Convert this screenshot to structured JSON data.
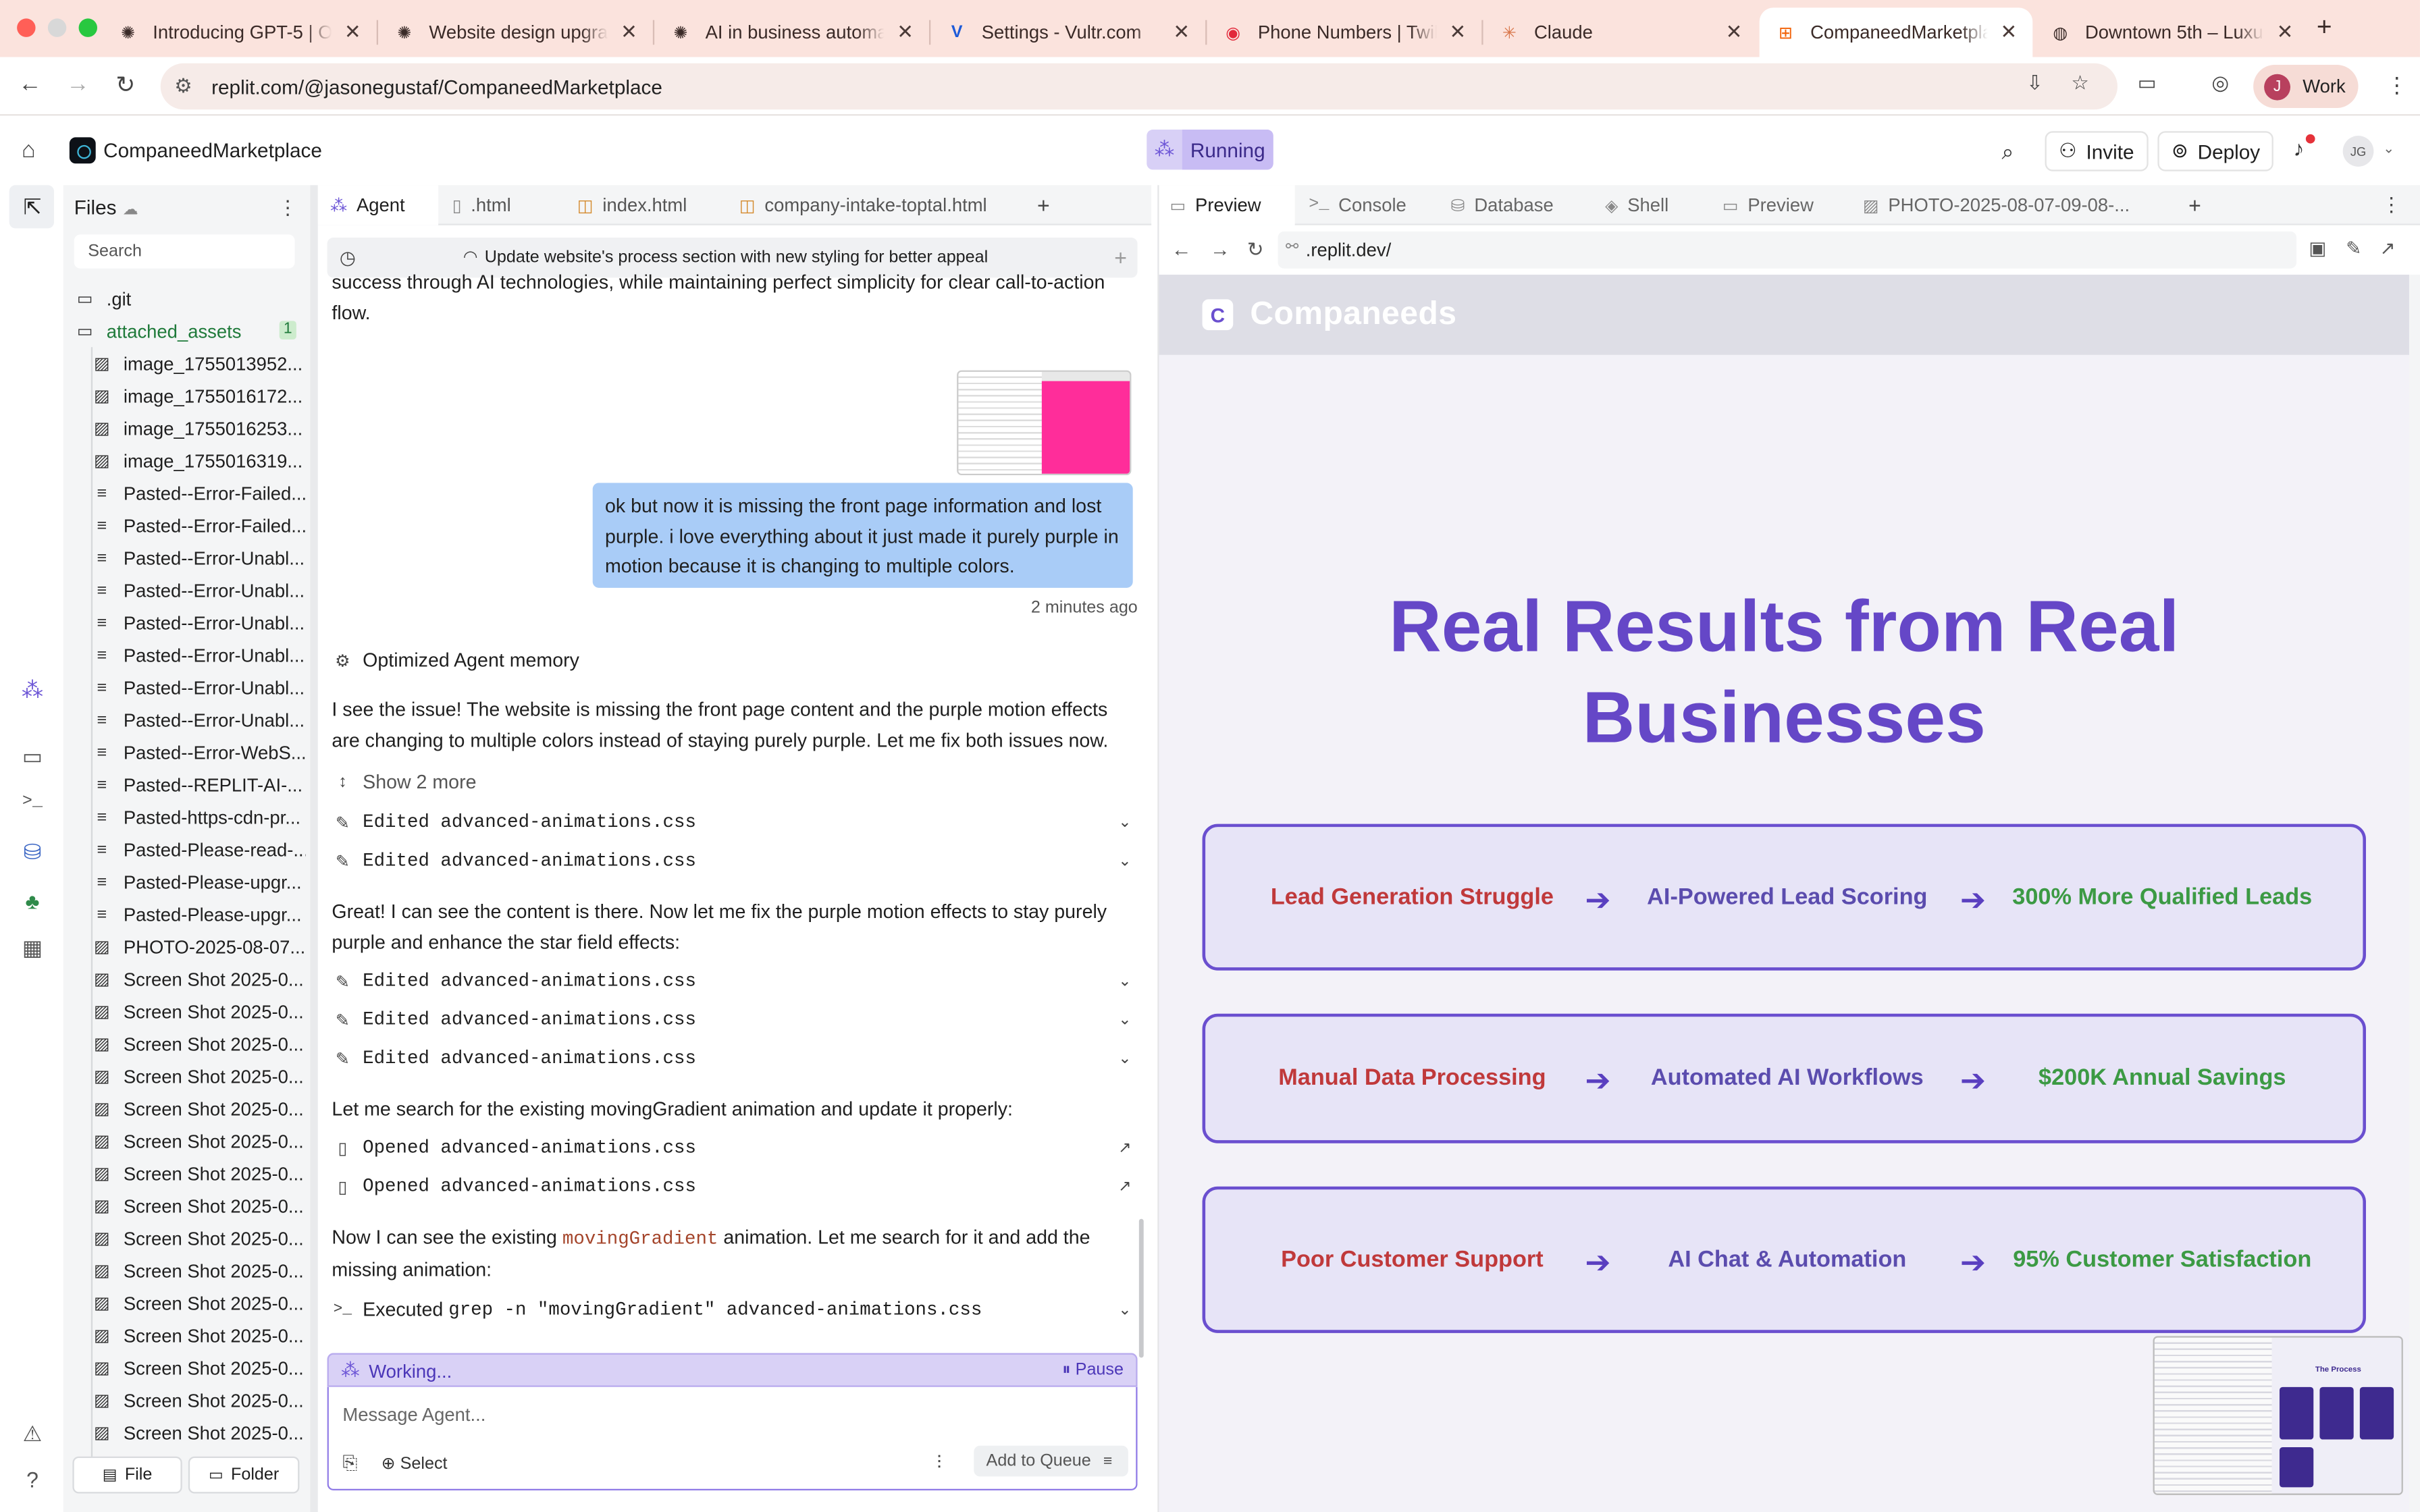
{
  "browser": {
    "tabs": [
      {
        "title": "Introducing GPT-5 | Op",
        "icon": "openai-icon"
      },
      {
        "title": "Website design upgrad",
        "icon": "openai-icon"
      },
      {
        "title": "AI in business automati",
        "icon": "openai-icon"
      },
      {
        "title": "Settings - Vultr.com",
        "icon": "vultr-icon"
      },
      {
        "title": "Phone Numbers | Twilio",
        "icon": "twilio-icon"
      },
      {
        "title": "Claude",
        "icon": "claude-icon"
      },
      {
        "title": "CompaneedMarketplac",
        "icon": "replit-icon",
        "active": true
      },
      {
        "title": "Downtown 5th – Luxury",
        "icon": "globe-icon"
      }
    ],
    "url": "replit.com/@jasonegustaf/CompaneedMarketplace",
    "profile_initial": "J",
    "profile_label": "Work"
  },
  "replit": {
    "project_name": "CompaneedMarketplace",
    "run_status": "Running",
    "invite_label": "Invite",
    "deploy_label": "Deploy",
    "avatar_initials": "JG"
  },
  "files": {
    "title": "Files",
    "search_placeholder": "Search",
    "items": [
      {
        "name": ".git",
        "type": "folder"
      },
      {
        "name": "attached_assets",
        "type": "folder",
        "badge": "1"
      },
      {
        "name": "image_1755013952...",
        "type": "image"
      },
      {
        "name": "image_1755016172...",
        "type": "image"
      },
      {
        "name": "image_1755016253...",
        "type": "image"
      },
      {
        "name": "image_1755016319...",
        "type": "image"
      },
      {
        "name": "Pasted--Error-Failed...",
        "type": "text"
      },
      {
        "name": "Pasted--Error-Failed...",
        "type": "text"
      },
      {
        "name": "Pasted--Error-Unabl...",
        "type": "text"
      },
      {
        "name": "Pasted--Error-Unabl...",
        "type": "text"
      },
      {
        "name": "Pasted--Error-Unabl...",
        "type": "text"
      },
      {
        "name": "Pasted--Error-Unabl...",
        "type": "text"
      },
      {
        "name": "Pasted--Error-Unabl...",
        "type": "text"
      },
      {
        "name": "Pasted--Error-Unabl...",
        "type": "text"
      },
      {
        "name": "Pasted--Error-WebS...",
        "type": "text"
      },
      {
        "name": "Pasted--REPLIT-AI-...",
        "type": "text"
      },
      {
        "name": "Pasted-https-cdn-pr...",
        "type": "text"
      },
      {
        "name": "Pasted-Please-read-...",
        "type": "text"
      },
      {
        "name": "Pasted-Please-upgr...",
        "type": "text"
      },
      {
        "name": "Pasted-Please-upgr...",
        "type": "text"
      },
      {
        "name": "PHOTO-2025-08-07...",
        "type": "image"
      },
      {
        "name": "Screen Shot 2025-0...",
        "type": "image"
      },
      {
        "name": "Screen Shot 2025-0...",
        "type": "image"
      },
      {
        "name": "Screen Shot 2025-0...",
        "type": "image"
      },
      {
        "name": "Screen Shot 2025-0...",
        "type": "image"
      },
      {
        "name": "Screen Shot 2025-0...",
        "type": "image"
      },
      {
        "name": "Screen Shot 2025-0...",
        "type": "image"
      },
      {
        "name": "Screen Shot 2025-0...",
        "type": "image"
      },
      {
        "name": "Screen Shot 2025-0...",
        "type": "image"
      },
      {
        "name": "Screen Shot 2025-0...",
        "type": "image"
      },
      {
        "name": "Screen Shot 2025-0...",
        "type": "image"
      },
      {
        "name": "Screen Shot 2025-0...",
        "type": "image"
      },
      {
        "name": "Screen Shot 2025-0...",
        "type": "image"
      },
      {
        "name": "Screen Shot 2025-0...",
        "type": "image"
      },
      {
        "name": "Screen Shot 2025-0...",
        "type": "image"
      },
      {
        "name": "Screen Shot 2025-0...",
        "type": "image"
      }
    ],
    "file_button": "File",
    "folder_button": "Folder"
  },
  "editor_tabs": [
    {
      "label": "Agent",
      "active": true
    },
    {
      "label": ".html"
    },
    {
      "label": "index.html"
    },
    {
      "label": "company-intake-toptal.html"
    }
  ],
  "agent": {
    "task_title": "Update website's process section with new styling for better appeal",
    "cut_text_line1": "success through AI technologies, while maintaining perfect simplicity for clear call-to-action",
    "cut_text_line2": "flow.",
    "user_message": "ok but now it is missing the front page information and lost purple. i love everything about it just made it purely purple in motion because it is changing to multiple colors.",
    "timestamp": "2 minutes ago",
    "memory_label": "Optimized Agent memory",
    "para1": "I see the issue! The website is missing the front page content and the purple motion effects are changing to multiple colors instead of staying purely purple. Let me fix both issues now.",
    "show_more": "Show 2 more",
    "edit1": "Edited advanced-animations.css",
    "edit2": "Edited advanced-animations.css",
    "para2": "Great! I can see the content is there. Now let me fix the purple motion effects to stay purely purple and enhance the star field effects:",
    "edit3": "Edited advanced-animations.css",
    "edit4": "Edited advanced-animations.css",
    "edit5": "Edited advanced-animations.css",
    "para3": "Let me search for the existing movingGradient animation and update it properly:",
    "open1": "Opened advanced-animations.css",
    "open2": "Opened advanced-animations.css",
    "para4_pre": "Now I can see the existing",
    "para4_code": "movingGradient",
    "para4_post": "animation. Let me search for it and add the",
    "para4_line2": "missing animation:",
    "exec_prefix": "Executed",
    "exec_cmd": "grep -n \"movingGradient\" advanced-animations.css",
    "working_label": "Working...",
    "pause_label": "Pause",
    "input_placeholder": "Message Agent...",
    "select_label": "Select",
    "queue_label": "Add to Queue"
  },
  "preview_tabs": [
    {
      "label": "Preview",
      "active": true
    },
    {
      "label": "Console"
    },
    {
      "label": "Database"
    },
    {
      "label": "Shell"
    },
    {
      "label": "Preview"
    },
    {
      "label": "PHOTO-2025-08-07-09-08-..."
    }
  ],
  "preview": {
    "url": ".replit.dev/",
    "brand": "Companeeds",
    "logo_letter": "C",
    "hero_line1": "Real Results from Real",
    "hero_line2": "Businesses",
    "results": [
      {
        "problem": "Lead Generation Struggle",
        "solution": "AI-Powered Lead Scoring",
        "outcome": "300% More Qualified Leads"
      },
      {
        "problem": "Manual Data Processing",
        "solution": "Automated AI Workflows",
        "outcome": "$200K Annual Savings"
      },
      {
        "problem": "Poor Customer Support",
        "solution": "AI Chat & Automation",
        "outcome": "95% Customer Satisfaction"
      }
    ],
    "arrow": "➔",
    "thumb_title": "The Process"
  },
  "colors": {
    "accent_purple": "#6547c7",
    "problem_red": "#c0393b",
    "outcome_green": "#3c9a44",
    "user_bubble": "#a9ccf7"
  }
}
